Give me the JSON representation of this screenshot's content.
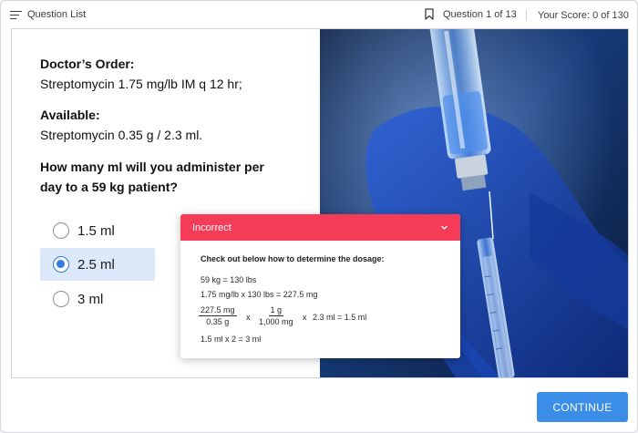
{
  "header": {
    "question_list_label": "Question List",
    "question_counter": "Question 1 of 13",
    "score": "Your Score: 0 of 130"
  },
  "problem": {
    "order_label": "Doctor’s Order:",
    "order_text": "Streptomycin 1.75 mg/lb IM q 12 hr;",
    "available_label": "Available:",
    "available_text": "Streptomycin 0.35 g / 2.3 ml.",
    "question": "How many ml will you administer per day to a 59 kg patient?"
  },
  "options": [
    {
      "label": "1.5 ml",
      "selected": false
    },
    {
      "label": "2.5 ml",
      "selected": true
    },
    {
      "label": "3 ml",
      "selected": false
    }
  ],
  "feedback": {
    "status": "Incorrect",
    "title": "Check out below how to determine the dosage:",
    "line1": "59 kg = 130 lbs",
    "line2": "1.75 mg/lb x 130 lbs = 227.5 mg",
    "frac1_num": "227.5 mg",
    "frac1_den": "0.35 g",
    "times1": "x",
    "frac2_num": "1 g",
    "frac2_den": "1,000 mg",
    "times2": "x",
    "result": "2.3 ml = 1.5 ml",
    "line4": "1.5 ml x 2 = 3 ml",
    "status_color": "#f53b57"
  },
  "continue_label": "CONTINUE",
  "colors": {
    "accent": "#3b8ee8",
    "selected_bg": "#dbe9fb",
    "radio_on": "#2f7be0"
  },
  "icons": {
    "question_list": "list-icon",
    "bookmark": "bookmark-icon",
    "collapse": "chevron-down-icon"
  }
}
